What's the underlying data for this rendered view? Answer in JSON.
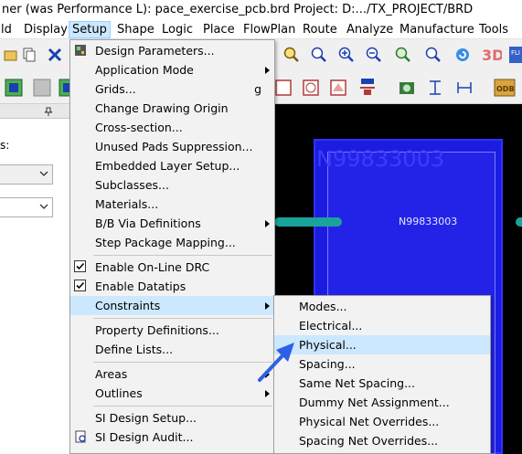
{
  "window": {
    "title": "ner (was Performance L): pace_exercise_pcb.brd  Project: D:.../TX_PROJECT/BRD"
  },
  "menubar": {
    "items": [
      "ld",
      "Display",
      "Setup",
      "Shape",
      "Logic",
      "Place",
      "FlowPlan",
      "Route",
      "Analyze",
      "Manufacture",
      "Tools"
    ],
    "active": "Setup"
  },
  "left_panel": {
    "label": "s:"
  },
  "canvas": {
    "component_refdes_large": "N99833003",
    "component_refdes_small": "N99833003"
  },
  "setup_menu": {
    "items": [
      {
        "label": "Design Parameters...",
        "icon": "design-parameters-icon"
      },
      {
        "label": "Application Mode",
        "submenu": true
      },
      {
        "label": "Grids...",
        "shortcut": "g"
      },
      {
        "label": "Change Drawing Origin"
      },
      {
        "label": "Cross-section..."
      },
      {
        "label": "Unused Pads Suppression..."
      },
      {
        "label": "Embedded Layer Setup..."
      },
      {
        "label": "Subclasses..."
      },
      {
        "label": "Materials..."
      },
      {
        "label": "B/B Via Definitions",
        "submenu": true
      },
      {
        "label": "Step Package Mapping..."
      },
      {
        "label": "Enable On-Line DRC",
        "checked": true
      },
      {
        "label": "Enable Datatips",
        "checked": true
      },
      {
        "label": "Constraints",
        "submenu": true,
        "highlighted": true
      },
      {
        "label": "Property Definitions..."
      },
      {
        "label": "Define Lists..."
      },
      {
        "label": "Areas",
        "submenu": true
      },
      {
        "label": "Outlines",
        "submenu": true
      },
      {
        "label": "SI Design Setup..."
      },
      {
        "label": "SI Design Audit...",
        "icon": "audit-icon"
      }
    ]
  },
  "constraints_submenu": {
    "items": [
      {
        "label": "Modes..."
      },
      {
        "label": "Electrical..."
      },
      {
        "label": "Physical...",
        "highlighted": true
      },
      {
        "label": "Spacing..."
      },
      {
        "label": "Same Net Spacing..."
      },
      {
        "label": "Dummy Net Assignment..."
      },
      {
        "label": "Physical Net Overrides..."
      },
      {
        "label": "Spacing Net Overrides..."
      }
    ]
  },
  "colors": {
    "highlight": "#cce8ff",
    "canvas_bg": "#000000",
    "pad_fill": "#1c1ce0",
    "trace": "#1aa39b",
    "annotation_arrow": "#2f5fe6"
  }
}
